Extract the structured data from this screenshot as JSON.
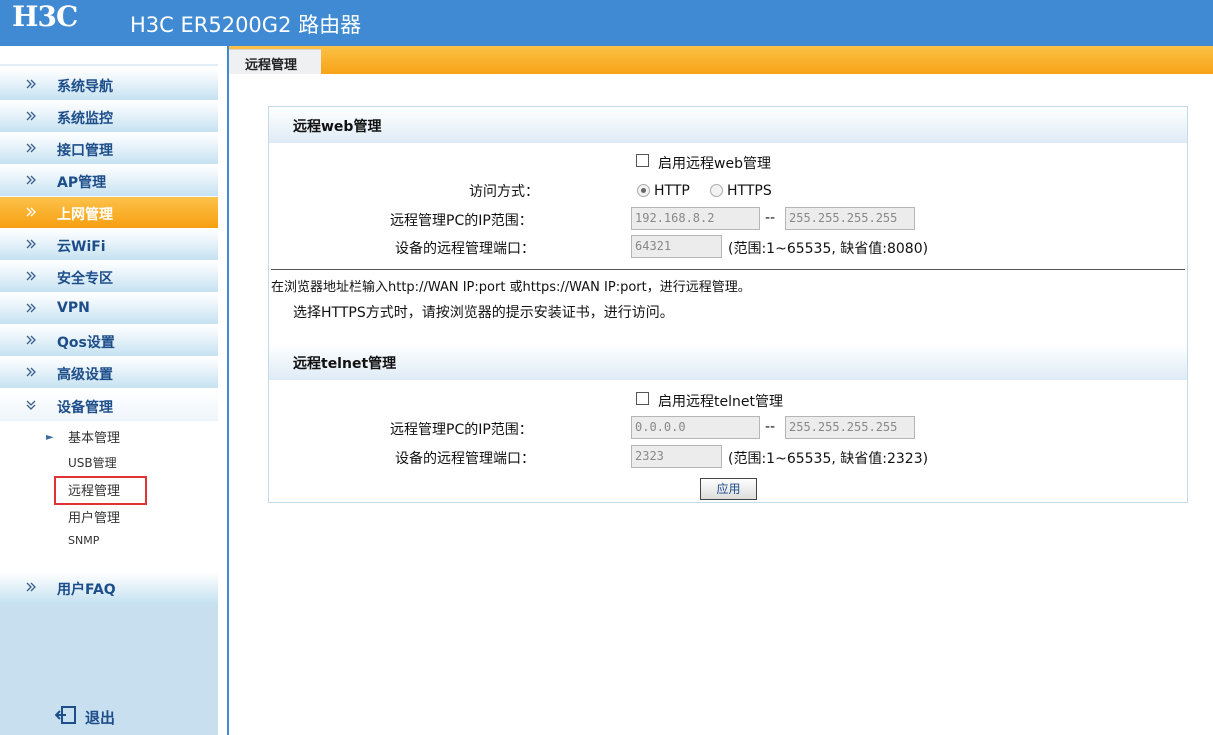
{
  "header": {
    "logo": "H3C",
    "title": "H3C ER5200G2 路由器"
  },
  "sidebar": {
    "items": [
      {
        "label": "系统导航"
      },
      {
        "label": "系统监控"
      },
      {
        "label": "接口管理"
      },
      {
        "label": "AP管理"
      },
      {
        "label": "上网管理"
      },
      {
        "label": "云WiFi"
      },
      {
        "label": "安全专区"
      },
      {
        "label": "VPN"
      },
      {
        "label": "Qos设置"
      },
      {
        "label": "高级设置"
      },
      {
        "label": "设备管理"
      }
    ],
    "sub_items": [
      {
        "label": "基本管理"
      },
      {
        "label": "USB管理"
      },
      {
        "label": "远程管理"
      },
      {
        "label": "用户管理"
      },
      {
        "label": "SNMP"
      }
    ],
    "faq": "用户FAQ",
    "logout": "退出"
  },
  "tab": {
    "label": "远程管理"
  },
  "web_section": {
    "title": "远程web管理",
    "enable_label": "启用远程web管理",
    "access_label": "访问方式：",
    "radio_http": "HTTP",
    "radio_https": "HTTPS",
    "ip_range_label": "远程管理PC的IP范围：",
    "ip_start": "192.168.8.2",
    "ip_end": "255.255.255.255",
    "port_label": "设备的远程管理端口：",
    "port_value": "64321",
    "port_hint": "(范围:1~65535, 缺省值:8080)",
    "dash": "--",
    "note1": "在浏览器地址栏输入http://WAN IP:port 或https://WAN IP:port，进行远程管理。",
    "note2": "选择HTTPS方式时，请按浏览器的提示安装证书，进行访问。"
  },
  "telnet_section": {
    "title": "远程telnet管理",
    "enable_label": "启用远程telnet管理",
    "ip_range_label": "远程管理PC的IP范围：",
    "ip_start": "0.0.0.0",
    "ip_end": "255.255.255.255",
    "port_label": "设备的远程管理端口：",
    "port_value": "2323",
    "port_hint": "(范围:1~65535, 缺省值:2323)",
    "dash": "--"
  },
  "apply_label": "应用",
  "colors": {
    "header_blue": "#3f8ad3",
    "active_orange": "#f79f12",
    "nav_text": "#1d4e8a",
    "highlight_box": "#e03434"
  }
}
